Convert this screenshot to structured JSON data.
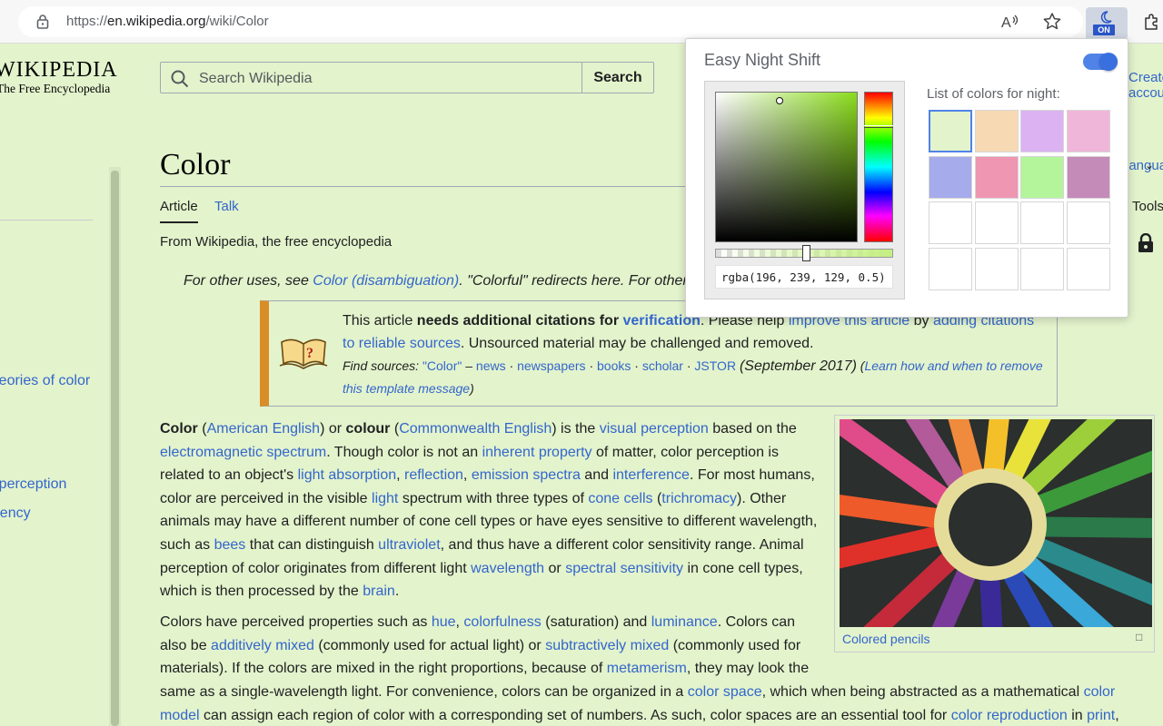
{
  "browser": {
    "url_prefix": "https://",
    "url_domain": "en.wikipedia.org",
    "url_path": "/wiki/Color",
    "extension_badge": "ON"
  },
  "wiki": {
    "logo_word": "WIKIPEDIA",
    "logo_sub": "The Free Encyclopedia",
    "search_placeholder": "Search Wikipedia",
    "search_button": "Search",
    "user_link": "Create account",
    "right_languages": "Languages",
    "right_tools": "Tools",
    "sidebar_toc": [
      "Theories of color",
      "Color perception",
      "Frequency"
    ],
    "title": "Color",
    "tab_article": "Article",
    "tab_talk": "Talk",
    "tagline": "From Wikipedia, the free encyclopedia",
    "hatnote_pre": "For other uses, see ",
    "hatnote_link": "Color (disambiguation)",
    "hatnote_post": ". \"Colorful\" redirects here. For other",
    "ambox": {
      "t1": "This article ",
      "t2": "needs additional citations for ",
      "t3": "verification",
      "t4": ". Please help ",
      "t5": "improve this article",
      "t6": " by ",
      "t7": "adding citations to reliable sources",
      "t8": ". Unsourced material may be challenged and removed.",
      "find": "Find sources:",
      "q": "\"Color\"",
      "dash": " – ",
      "news": "news",
      "newspapers": "newspapers",
      "books": "books",
      "scholar": "scholar",
      "jstor": "JSTOR",
      "date": "(September 2017)",
      "learn": "Learn how and when to remove this template message"
    },
    "caption": "Colored pencils"
  },
  "popup": {
    "title": "Easy Night Shift",
    "list_label": "List of colors for night:",
    "rgba_value": "rgba(196, 239, 129, 0.5)",
    "toggle_on": true,
    "swatches": [
      "#e3f3cc",
      "#f7d9b4",
      "#dcb2f2",
      "#f0b6d9",
      "#a6abec",
      "#ef96b3",
      "#b4f59b",
      "#c48ab8",
      "#ffffff",
      "#ffffff",
      "#ffffff",
      "#ffffff",
      "#ffffff",
      "#ffffff",
      "#ffffff",
      "#ffffff"
    ]
  },
  "colors": {
    "page_background": "#e3f3cc",
    "link": "#3366cc",
    "toggle_accent": "#4f83e7",
    "ambox_stripe": "#d98d28"
  }
}
